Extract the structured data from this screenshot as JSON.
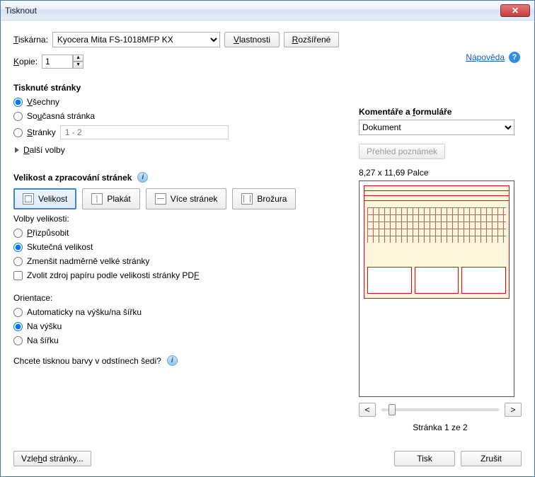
{
  "window": {
    "title": "Tisknout"
  },
  "help": {
    "label": "Nápověda"
  },
  "printer": {
    "label_html": "Tiskárna:",
    "label_key": "T",
    "selected": "Kyocera Mita FS-1018MFP KX",
    "properties_btn": "Vlastnosti",
    "properties_key": "V",
    "advanced_btn": "Rozšířené",
    "advanced_key": "R"
  },
  "copies": {
    "label": "Kopie:",
    "label_key": "K",
    "value": "1"
  },
  "pages_to_print": {
    "heading": "Tisknuté stránky",
    "all": "Všechny",
    "all_key": "V",
    "current": "Současná stránka",
    "current_key": "u",
    "range_label": "Stránky",
    "range_key": "S",
    "range_placeholder": "1 - 2",
    "more": "Další volby",
    "more_key": "D",
    "selected": "all"
  },
  "size_handling": {
    "heading": "Velikost a zpracování stránek",
    "tabs": {
      "size": "Velikost",
      "poster": "Plakát",
      "multi": "Více stránek",
      "brochure": "Brožura"
    },
    "options_label": "Volby velikosti:",
    "fit": "Přizpůsobit",
    "fit_key": "P",
    "actual": "Skutečná velikost",
    "shrink": "Zmenšit nadměrně velké stránky",
    "paper_source": "Zvolit zdroj papíru podle velikosti stránky PDF",
    "paper_source_key": "F",
    "selected": "actual"
  },
  "orientation": {
    "heading": "Orientace:",
    "auto": "Automaticky na výšku/na šířku",
    "portrait": "Na výšku",
    "landscape": "Na šířku",
    "selected": "portrait"
  },
  "grayscale_question": "Chcete tisknou barvy v odstínech šedi?",
  "comments": {
    "heading": "Komentáře a formuláře",
    "heading_key": "f",
    "selected": "Dokument",
    "summary_btn": "Přehled poznámek"
  },
  "preview": {
    "dimensions": "8,27 x 11,69 Palce",
    "prev": "<",
    "next": ">",
    "page_label": "Stránka 1 ze 2"
  },
  "footer": {
    "page_setup": "Vzhled stránky...",
    "page_setup_key": "h",
    "print": "Tisk",
    "cancel": "Zrušit"
  }
}
